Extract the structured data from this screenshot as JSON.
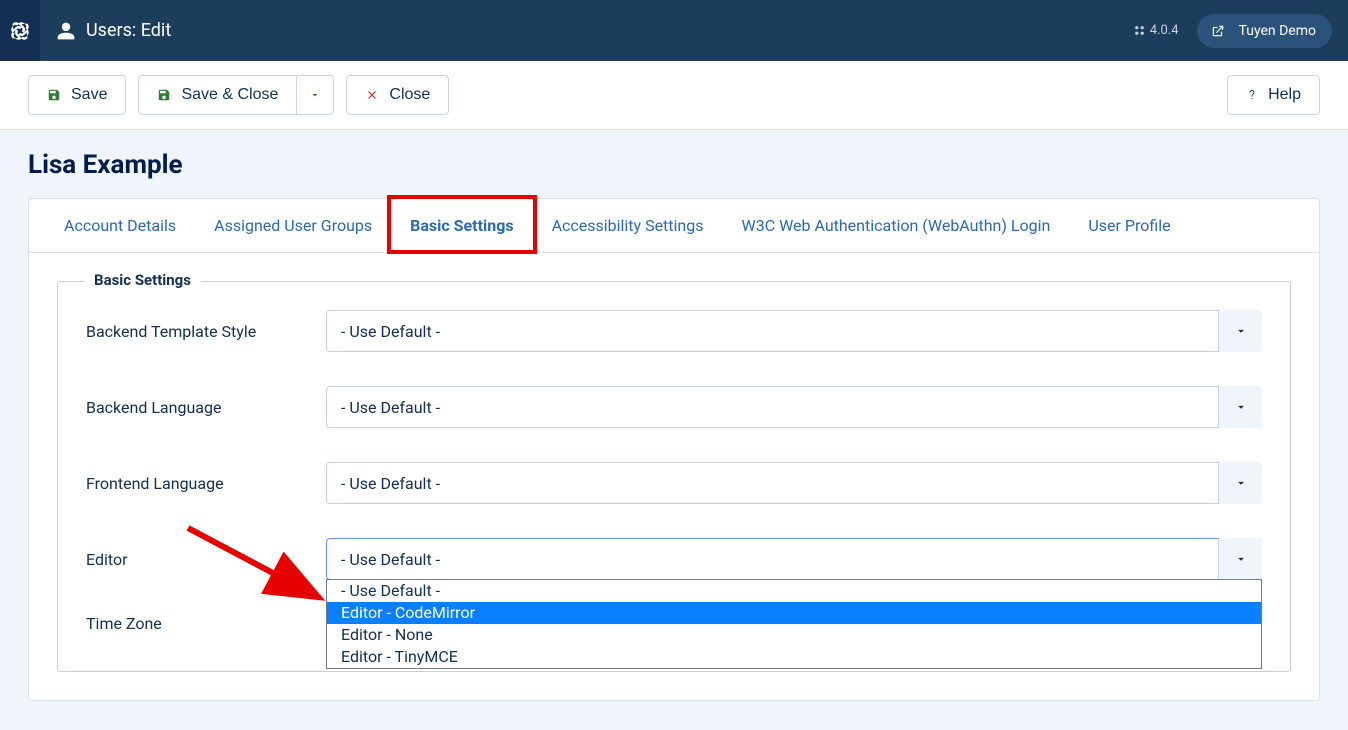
{
  "header": {
    "title": "Users: Edit",
    "version": "4.0.4",
    "username": "Tuyen Demo"
  },
  "toolbar": {
    "save": "Save",
    "save_close": "Save & Close",
    "close": "Close",
    "help": "Help"
  },
  "page": {
    "heading": "Lisa Example"
  },
  "tabs": [
    {
      "label": "Account Details",
      "active": false
    },
    {
      "label": "Assigned User Groups",
      "active": false
    },
    {
      "label": "Basic Settings",
      "active": true
    },
    {
      "label": "Accessibility Settings",
      "active": false
    },
    {
      "label": "W3C Web Authentication (WebAuthn) Login",
      "active": false
    },
    {
      "label": "User Profile",
      "active": false
    }
  ],
  "fieldset": {
    "legend": "Basic Settings",
    "fields": {
      "backend_template_style": {
        "label": "Backend Template Style",
        "value": "- Use Default -"
      },
      "backend_language": {
        "label": "Backend Language",
        "value": "- Use Default -"
      },
      "frontend_language": {
        "label": "Frontend Language",
        "value": "- Use Default -"
      },
      "editor": {
        "label": "Editor",
        "value": "- Use Default -",
        "options": [
          "- Use Default -",
          "Editor - CodeMirror",
          "Editor - None",
          "Editor - TinyMCE"
        ],
        "highlighted_index": 1
      },
      "time_zone": {
        "label": "Time Zone",
        "value": ""
      }
    }
  },
  "annotation": {
    "highlight_tab_index": 2
  }
}
